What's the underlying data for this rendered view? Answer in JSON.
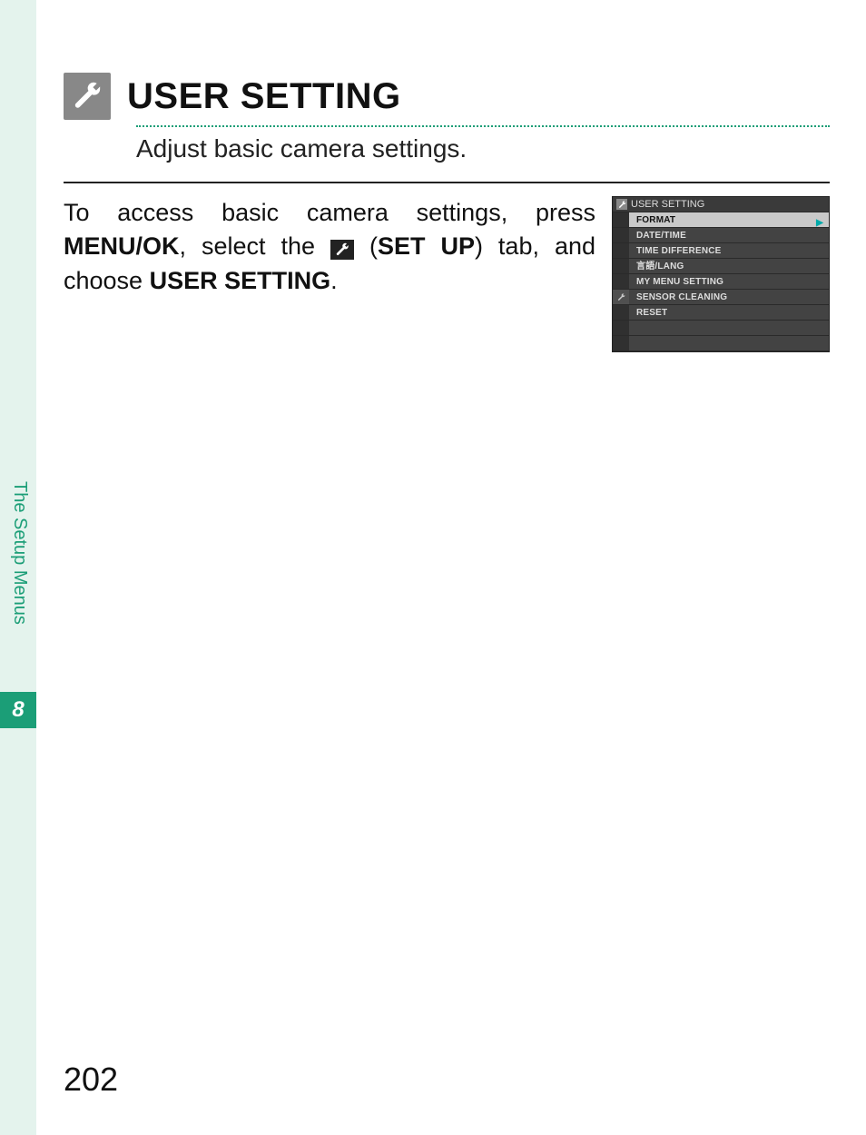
{
  "chapter": {
    "label": "The Setup Menus",
    "number": "8"
  },
  "title": "USER SETTING",
  "subtitle": "Adjust basic camera settings.",
  "body": {
    "part1": "To access basic camera settings, press ",
    "menu_ok": "MENU/OK",
    "part2": ", select the ",
    "setup_label": "SET UP",
    "part3": ") tab, and choose ",
    "user_setting_label": "USER SETTING",
    "part4": "."
  },
  "screenshot": {
    "header": "USER SETTING",
    "items": [
      {
        "label": "FORMAT",
        "highlight": true,
        "arrow": true
      },
      {
        "label": "DATE/TIME"
      },
      {
        "label": "TIME DIFFERENCE"
      },
      {
        "label": "言語/LANG"
      },
      {
        "label": "MY MENU SETTING"
      },
      {
        "label": "SENSOR CLEANING"
      },
      {
        "label": "RESET"
      },
      {
        "label": ""
      },
      {
        "label": ""
      }
    ]
  },
  "page_number": "202"
}
